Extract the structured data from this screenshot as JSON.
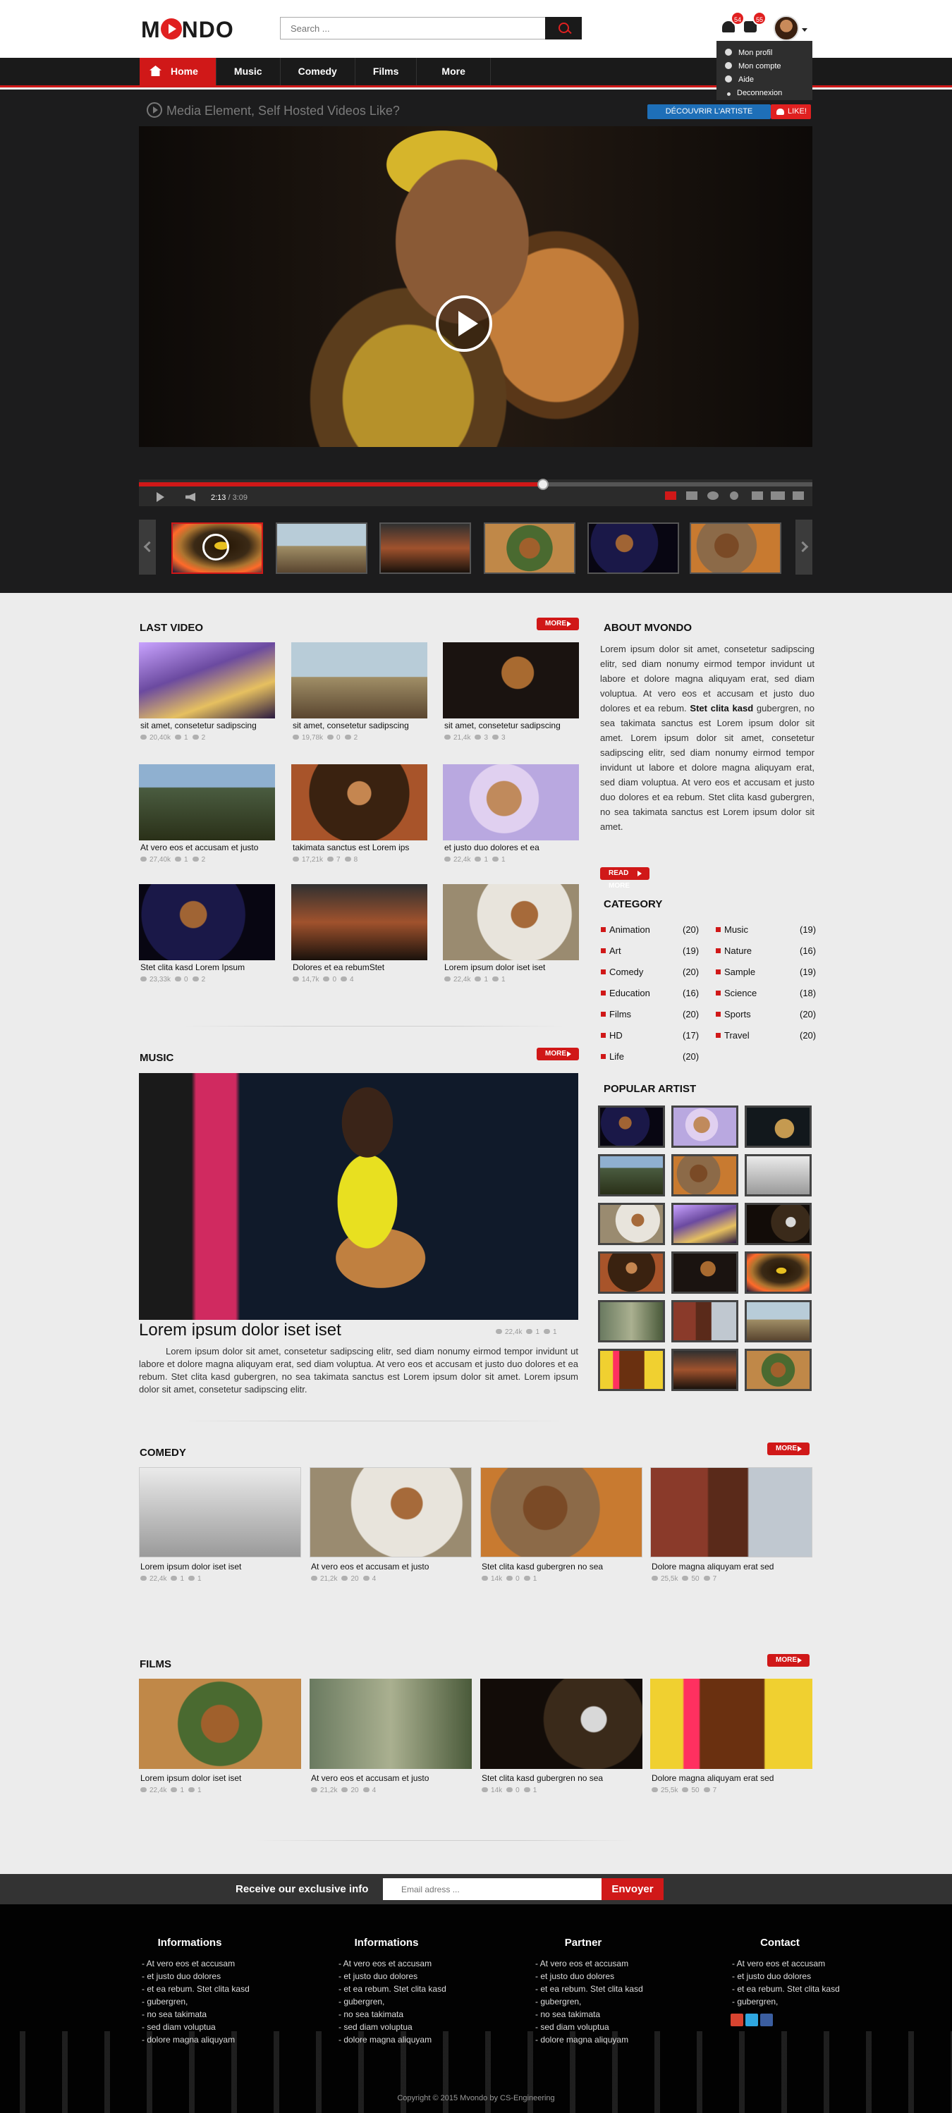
{
  "brand": {
    "logo_left": "M",
    "logo_right": "NDO"
  },
  "header": {
    "search_placeholder": "Search ...",
    "notifications_badge": "54",
    "messages_badge": "55",
    "dropdown": [
      "Mon profil",
      "Mon compte",
      "Aide",
      "Deconnexion"
    ]
  },
  "nav": [
    "Home",
    "Music",
    "Comedy",
    "Films",
    "More"
  ],
  "hero": {
    "video_title": "Media Element, Self Hosted Videos Like?",
    "discover_label": "DÉCOUVRIR L'ARTISTE",
    "like_label": "LIKE!",
    "time_current": "2:13",
    "time_total": "/ 3:09",
    "progress": 0.6
  },
  "last_video": {
    "title": "LAST VIDEO",
    "more": "MORE",
    "items": [
      {
        "label": "sit amet, consetetur sadipscing",
        "views": "20,40k",
        "comments": "1",
        "likes": "2"
      },
      {
        "label": "sit amet, consetetur sadipscing",
        "views": "19,78k",
        "comments": "0",
        "likes": "2"
      },
      {
        "label": "sit amet, consetetur sadipscing",
        "views": "21,4k",
        "comments": "3",
        "likes": "3"
      },
      {
        "label": "At vero eos et accusam et justo",
        "views": "27,40k",
        "comments": "1",
        "likes": "2"
      },
      {
        "label": "takimata sanctus est Lorem ips",
        "views": "17,21k",
        "comments": "7",
        "likes": "8"
      },
      {
        "label": "et justo duo dolores et ea",
        "views": "22,4k",
        "comments": "1",
        "likes": "1"
      },
      {
        "label": "Stet clita kasd  Lorem Ipsum",
        "views": "23,33k",
        "comments": "0",
        "likes": "2"
      },
      {
        "label": "Dolores et ea rebumStet",
        "views": "14,7k",
        "comments": "0",
        "likes": "4"
      },
      {
        "label": "Lorem ipsum dolor iset iset",
        "views": "22,4k",
        "comments": "1",
        "likes": "1"
      }
    ]
  },
  "about": {
    "title": "ABOUT MVONDO",
    "text_1": "Lorem ipsum dolor sit amet, consetetur sadipscing elitr, sed diam nonumy eirmod tempor invidunt ut labore et dolore magna aliquyam erat, sed diam voluptua. At vero eos et accusam et justo duo dolores et ea rebum. ",
    "text_bold": "Stet clita kasd",
    "text_2": " gubergren, no sea takimata sanctus est Lorem ipsum dolor sit amet. Lorem ipsum dolor sit amet, consetetur sadipscing elitr, sed diam nonumy eirmod tempor invidunt ut labore et dolore magna aliquyam erat, sed diam voluptua. At vero eos et accusam et justo duo dolores et ea rebum. Stet clita kasd gubergren, no sea takimata sanctus est Lorem ipsum dolor sit amet.",
    "read_more": "READ MORE"
  },
  "category": {
    "title": "CATEGORY",
    "left": [
      {
        "name": "Animation",
        "count": "(20)"
      },
      {
        "name": "Art",
        "count": "(19)"
      },
      {
        "name": "Comedy",
        "count": "(20)"
      },
      {
        "name": "Education",
        "count": "(16)"
      },
      {
        "name": "Films",
        "count": "(20)"
      },
      {
        "name": "HD",
        "count": "(17)"
      },
      {
        "name": "Life",
        "count": "(20)"
      }
    ],
    "right": [
      {
        "name": "Music",
        "count": "(19)"
      },
      {
        "name": "Nature",
        "count": "(16)"
      },
      {
        "name": "Sample",
        "count": "(19)"
      },
      {
        "name": "Science",
        "count": "(18)"
      },
      {
        "name": "Sports",
        "count": "(20)"
      },
      {
        "name": "Travel",
        "count": "(20)"
      }
    ]
  },
  "popular_artist": {
    "title": "POPULAR ARTIST"
  },
  "music": {
    "title": "MUSIC",
    "more": "MORE",
    "headline": "Lorem ipsum dolor iset iset",
    "views": "22,4k",
    "comments": "1",
    "likes": "1",
    "text": "Lorem ipsum dolor sit amet, consetetur sadipscing elitr, sed diam nonumy eirmod tempor invidunt ut labore et dolore magna aliquyam erat, sed diam voluptua. At vero eos et accusam et justo duo dolores et ea rebum. Stet clita kasd gubergren, no sea takimata sanctus est Lorem ipsum dolor sit amet. Lorem ipsum dolor sit amet, consetetur sadipscing elitr."
  },
  "comedy": {
    "title": "COMEDY",
    "more": "MORE",
    "items": [
      {
        "label": "Lorem ipsum dolor iset iset",
        "views": "22,4k",
        "comments": "1",
        "likes": "1"
      },
      {
        "label": "At vero eos et accusam et justo",
        "views": "21,2k",
        "comments": "20",
        "likes": "4"
      },
      {
        "label": "Stet clita kasd gubergren no sea",
        "views": "14k",
        "comments": "0",
        "likes": "1"
      },
      {
        "label": "Dolore magna aliquyam erat sed",
        "views": "25,5k",
        "comments": "50",
        "likes": "7"
      }
    ]
  },
  "films": {
    "title": "FILMS",
    "more": "MORE",
    "items": [
      {
        "label": "Lorem ipsum dolor iset iset",
        "views": "22,4k",
        "comments": "1",
        "likes": "1"
      },
      {
        "label": "At vero eos et accusam et justo",
        "views": "21,2k",
        "comments": "20",
        "likes": "4"
      },
      {
        "label": "Stet clita kasd gubergren no sea",
        "views": "14k",
        "comments": "0",
        "likes": "1"
      },
      {
        "label": "Dolore magna aliquyam erat sed",
        "views": "25,5k",
        "comments": "50",
        "likes": "7"
      }
    ]
  },
  "newsletter": {
    "label": "Receive our exclusive info",
    "placeholder": "Email adress ...",
    "button": "Envoyer"
  },
  "footer": {
    "columns": [
      {
        "title": "Informations",
        "links": [
          "- At vero eos et accusam",
          "- et justo duo dolores",
          "- et ea rebum. Stet clita kasd",
          "- gubergren,",
          "- no sea takimata",
          "- sed diam voluptua",
          "- dolore magna aliquyam"
        ]
      },
      {
        "title": "Informations",
        "links": [
          "- At vero eos et accusam",
          "- et justo duo dolores",
          "- et ea rebum. Stet clita kasd",
          "- gubergren,",
          "- no sea takimata",
          "- sed diam voluptua",
          "- dolore magna aliquyam"
        ]
      },
      {
        "title": "Partner",
        "links": [
          "- At vero eos et accusam",
          "- et justo duo dolores",
          "- et ea rebum. Stet clita kasd",
          "- gubergren,",
          "- no sea takimata",
          "- sed diam voluptua",
          "- dolore magna aliquyam"
        ]
      },
      {
        "title": "Contact",
        "links": [
          "- At vero eos et accusam",
          "- et justo duo dolores",
          "- et ea rebum. Stet clita kasd",
          "- gubergren,"
        ]
      }
    ],
    "copyright": "Copyright © 2015 Mvondo by CS-Engineering"
  },
  "colors": {
    "accent": "#d01818",
    "dark": "#1c1c1d",
    "blue": "#1e6fb8"
  }
}
